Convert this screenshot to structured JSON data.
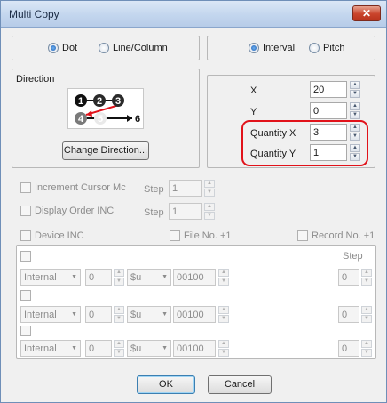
{
  "window": {
    "title": "Multi Copy",
    "close_glyph": "✕"
  },
  "mode": {
    "dot": "Dot",
    "line_column": "Line/Column",
    "selected": "Dot"
  },
  "spacing_mode": {
    "interval": "Interval",
    "pitch": "Pitch",
    "selected": "Interval"
  },
  "direction": {
    "heading": "Direction",
    "order": [
      "1",
      "2",
      "3",
      "4",
      "5",
      "6"
    ],
    "change_button": "Change Direction..."
  },
  "interval": {
    "x_label": "X",
    "x_value": "20",
    "y_label": "Y",
    "y_value": "0",
    "qx_label": "Quantity X",
    "qx_value": "3",
    "qy_label": "Quantity Y",
    "qy_value": "1",
    "highlight_color": "#e1121a"
  },
  "options": {
    "increment_cursor": "Increment Cursor Mc",
    "display_order": "Display Order INC",
    "step_label": "Step",
    "step_value": "1",
    "device_inc": "Device INC",
    "file_no": "File No. +1",
    "record_no": "Record No. +1"
  },
  "device_rows": {
    "step_header": "Step",
    "rows": [
      {
        "type": "Internal",
        "index": "0",
        "prefix": "$u",
        "address": "00100",
        "step": "0"
      },
      {
        "type": "Internal",
        "index": "0",
        "prefix": "$u",
        "address": "00100",
        "step": "0"
      },
      {
        "type": "Internal",
        "index": "0",
        "prefix": "$u",
        "address": "00100",
        "step": "0"
      }
    ]
  },
  "footer": {
    "ok": "OK",
    "cancel": "Cancel"
  }
}
